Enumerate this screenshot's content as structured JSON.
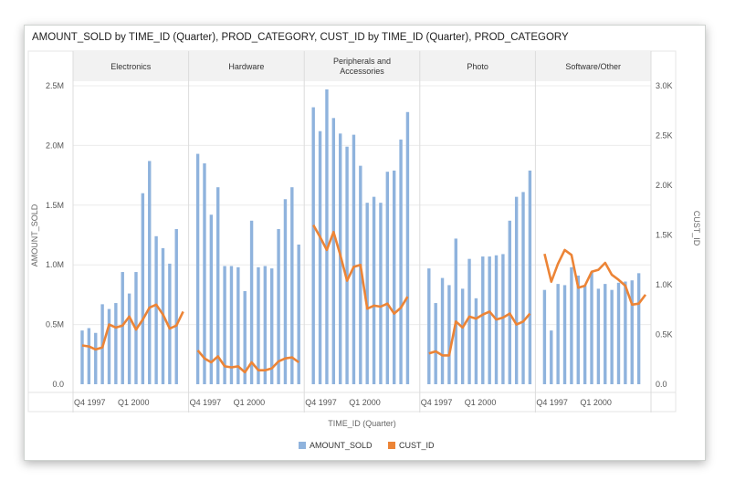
{
  "title": "AMOUNT_SOLD by TIME_ID (Quarter), PROD_CATEGORY, CUST_ID by TIME_ID (Quarter), PROD_CATEGORY",
  "chart_data": {
    "type": "bar",
    "combo": "bar+line",
    "title": "AMOUNT_SOLD by TIME_ID (Quarter), PROD_CATEGORY, CUST_ID by TIME_ID (Quarter), PROD_CATEGORY",
    "xlabel": "TIME_ID (Quarter)",
    "ylabel": "AMOUNT_SOLD",
    "y2label": "CUST_ID",
    "ylim": [
      0,
      2500000
    ],
    "y2lim": [
      0,
      3000
    ],
    "yticks": [
      "0.0",
      "0.5M",
      "1.0M",
      "1.5M",
      "2.0M",
      "2.5M"
    ],
    "y2ticks": [
      "0.0",
      "0.5K",
      "1.0K",
      "1.5K",
      "2.0K",
      "2.5K",
      "3.0K"
    ],
    "xtick_labels": [
      "Q4 1997",
      "Q1 2000"
    ],
    "grid": true,
    "legend_position": "bottom",
    "colors": {
      "bars": "#8fb3dd",
      "line": "#ec8436"
    },
    "legend": [
      "AMOUNT_SOLD",
      "CUST_ID"
    ],
    "panels": [
      {
        "name": "Electronics",
        "bars": [
          450000,
          470000,
          430000,
          670000,
          630000,
          680000,
          940000,
          760000,
          940000,
          1600000,
          1870000,
          1240000,
          1140000,
          1010000,
          1300000
        ],
        "line": [
          390,
          380,
          350,
          370,
          600,
          570,
          590,
          680,
          550,
          650,
          770,
          800,
          700,
          560,
          590,
          730
        ]
      },
      {
        "name": "Hardware",
        "bars": [
          1930000,
          1850000,
          1420000,
          1650000,
          990000,
          990000,
          980000,
          780000,
          1370000,
          980000,
          990000,
          970000,
          1300000,
          1550000,
          1650000,
          1170000
        ],
        "line": [
          340,
          260,
          220,
          280,
          180,
          170,
          180,
          120,
          220,
          140,
          140,
          160,
          230,
          260,
          270,
          220
        ]
      },
      {
        "name": "Peripherals and Accessories",
        "bars": [
          2320000,
          2120000,
          2470000,
          2230000,
          2100000,
          1990000,
          2090000,
          1830000,
          1520000,
          1570000,
          1520000,
          1780000,
          1790000,
          2050000,
          2280000
        ],
        "line": [
          1600,
          1480,
          1350,
          1530,
          1300,
          1040,
          1180,
          1200,
          760,
          790,
          780,
          810,
          710,
          770,
          880
        ]
      },
      {
        "name": "Photo",
        "bars": [
          970000,
          680000,
          890000,
          830000,
          1220000,
          800000,
          1050000,
          720000,
          1070000,
          1070000,
          1080000,
          1090000,
          1370000,
          1570000,
          1610000,
          1790000
        ],
        "line": [
          310,
          330,
          290,
          290,
          630,
          570,
          680,
          660,
          700,
          730,
          650,
          670,
          710,
          600,
          630,
          710
        ]
      },
      {
        "name": "Software/Other",
        "bars": [
          790000,
          450000,
          840000,
          830000,
          980000,
          910000,
          830000,
          940000,
          800000,
          840000,
          790000,
          850000,
          860000,
          870000,
          930000
        ],
        "line": [
          1310,
          1030,
          1210,
          1350,
          1300,
          970,
          990,
          1130,
          1150,
          1220,
          1100,
          1050,
          990,
          800,
          810,
          900
        ]
      }
    ]
  }
}
